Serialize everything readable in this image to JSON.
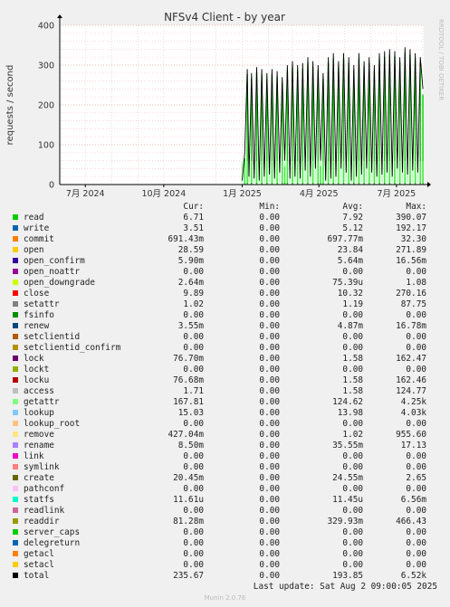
{
  "chart_data": {
    "type": "line",
    "title": "NFSv4 Client - by year",
    "ylabel": "requests / second",
    "side_label": "RRDTOOL / TOBI OETIKER",
    "ylim": [
      0,
      400
    ],
    "yticks": [
      0,
      100,
      200,
      300,
      400
    ],
    "xlim": [
      "2024-06-01",
      "2025-08-02"
    ],
    "xticks": [
      {
        "date": "2024-07-01",
        "label": "7月 2024"
      },
      {
        "date": "2024-10-01",
        "label": "10月 2024"
      },
      {
        "date": "2025-01-01",
        "label": "1月 2025"
      },
      {
        "date": "2025-04-01",
        "label": "4月 2025"
      },
      {
        "date": "2025-07-01",
        "label": "7月 2025"
      }
    ],
    "total_series": {
      "name": "total",
      "x": [
        "2025-01-01",
        "2025-01-04",
        "2025-01-07",
        "2025-01-09",
        "2025-01-12",
        "2025-01-15",
        "2025-01-18",
        "2025-01-21",
        "2025-01-24",
        "2025-01-27",
        "2025-01-30",
        "2025-02-02",
        "2025-02-05",
        "2025-02-08",
        "2025-02-11",
        "2025-02-14",
        "2025-02-17",
        "2025-02-20",
        "2025-02-23",
        "2025-02-26",
        "2025-03-01",
        "2025-03-04",
        "2025-03-07",
        "2025-03-10",
        "2025-03-13",
        "2025-03-16",
        "2025-03-19",
        "2025-03-22",
        "2025-03-25",
        "2025-03-28",
        "2025-03-31",
        "2025-04-03",
        "2025-04-06",
        "2025-04-09",
        "2025-04-12",
        "2025-04-15",
        "2025-04-18",
        "2025-04-21",
        "2025-04-24",
        "2025-04-27",
        "2025-04-30",
        "2025-05-03",
        "2025-05-06",
        "2025-05-09",
        "2025-05-12",
        "2025-05-15",
        "2025-05-18",
        "2025-05-21",
        "2025-05-24",
        "2025-05-27",
        "2025-05-30",
        "2025-06-02",
        "2025-06-05",
        "2025-06-08",
        "2025-06-11",
        "2025-06-14",
        "2025-06-17",
        "2025-06-20",
        "2025-06-23",
        "2025-06-26",
        "2025-06-29",
        "2025-07-02",
        "2025-07-05",
        "2025-07-08",
        "2025-07-11",
        "2025-07-14",
        "2025-07-17",
        "2025-07-20",
        "2025-07-23",
        "2025-07-26",
        "2025-07-29",
        "2025-08-01"
      ],
      "y": [
        10,
        80,
        290,
        20,
        280,
        15,
        295,
        10,
        290,
        20,
        280,
        25,
        290,
        15,
        285,
        30,
        270,
        60,
        300,
        15,
        310,
        20,
        300,
        15,
        305,
        35,
        320,
        20,
        310,
        40,
        300,
        60,
        280,
        10,
        320,
        15,
        330,
        20,
        310,
        40,
        330,
        30,
        320,
        10,
        300,
        20,
        330,
        25,
        310,
        40,
        320,
        30,
        300,
        20,
        330,
        25,
        335,
        30,
        340,
        20,
        335,
        40,
        320,
        30,
        345,
        25,
        340,
        35,
        330,
        30,
        320,
        240
      ]
    },
    "series": [
      {
        "name": "read",
        "cur": "6.71",
        "min": "0.00",
        "avg": "7.92",
        "max": "390.07",
        "color": "#00cc00"
      },
      {
        "name": "write",
        "cur": "3.51",
        "min": "0.00",
        "avg": "5.12",
        "max": "192.17",
        "color": "#0066b3"
      },
      {
        "name": "commit",
        "cur": "691.43m",
        "min": "0.00",
        "avg": "697.77m",
        "max": "32.30",
        "color": "#ff8000"
      },
      {
        "name": "open",
        "cur": "28.59",
        "min": "0.00",
        "avg": "23.84",
        "max": "271.89",
        "color": "#ffcc00"
      },
      {
        "name": "open_confirm",
        "cur": "5.90m",
        "min": "0.00",
        "avg": "5.64m",
        "max": "16.56m",
        "color": "#330099"
      },
      {
        "name": "open_noattr",
        "cur": "0.00",
        "min": "0.00",
        "avg": "0.00",
        "max": "0.00",
        "color": "#990099"
      },
      {
        "name": "open_downgrade",
        "cur": "2.64m",
        "min": "0.00",
        "avg": "75.39u",
        "max": "1.08",
        "color": "#ccff00"
      },
      {
        "name": "close",
        "cur": "9.89",
        "min": "0.00",
        "avg": "10.32",
        "max": "270.16",
        "color": "#ff0000"
      },
      {
        "name": "setattr",
        "cur": "1.02",
        "min": "0.00",
        "avg": "1.19",
        "max": "87.75",
        "color": "#808080"
      },
      {
        "name": "fsinfo",
        "cur": "0.00",
        "min": "0.00",
        "avg": "0.00",
        "max": "0.00",
        "color": "#008f00"
      },
      {
        "name": "renew",
        "cur": "3.55m",
        "min": "0.00",
        "avg": "4.87m",
        "max": "16.78m",
        "color": "#00487d"
      },
      {
        "name": "setclientid",
        "cur": "0.00",
        "min": "0.00",
        "avg": "0.00",
        "max": "0.00",
        "color": "#b35a00"
      },
      {
        "name": "setclientid_confirm",
        "cur": "0.00",
        "min": "0.00",
        "avg": "0.00",
        "max": "0.00",
        "color": "#b38f00"
      },
      {
        "name": "lock",
        "cur": "76.70m",
        "min": "0.00",
        "avg": "1.58",
        "max": "162.47",
        "color": "#6b006b"
      },
      {
        "name": "lockt",
        "cur": "0.00",
        "min": "0.00",
        "avg": "0.00",
        "max": "0.00",
        "color": "#8fb300"
      },
      {
        "name": "locku",
        "cur": "76.68m",
        "min": "0.00",
        "avg": "1.58",
        "max": "162.46",
        "color": "#b30000"
      },
      {
        "name": "access",
        "cur": "1.71",
        "min": "0.00",
        "avg": "1.58",
        "max": "124.77",
        "color": "#bebebe"
      },
      {
        "name": "getattr",
        "cur": "167.81",
        "min": "0.00",
        "avg": "124.62",
        "max": "4.25k",
        "color": "#80ff80"
      },
      {
        "name": "lookup",
        "cur": "15.03",
        "min": "0.00",
        "avg": "13.98",
        "max": "4.03k",
        "color": "#80c9ff"
      },
      {
        "name": "lookup_root",
        "cur": "0.00",
        "min": "0.00",
        "avg": "0.00",
        "max": "0.00",
        "color": "#ffc080"
      },
      {
        "name": "remove",
        "cur": "427.04m",
        "min": "0.00",
        "avg": "1.02",
        "max": "955.60",
        "color": "#ffe680"
      },
      {
        "name": "rename",
        "cur": "8.50m",
        "min": "0.00",
        "avg": "35.55m",
        "max": "17.13",
        "color": "#aa80ff"
      },
      {
        "name": "link",
        "cur": "0.00",
        "min": "0.00",
        "avg": "0.00",
        "max": "0.00",
        "color": "#ee00cc"
      },
      {
        "name": "symlink",
        "cur": "0.00",
        "min": "0.00",
        "avg": "0.00",
        "max": "0.00",
        "color": "#ff8080"
      },
      {
        "name": "create",
        "cur": "20.45m",
        "min": "0.00",
        "avg": "24.55m",
        "max": "2.65",
        "color": "#666600"
      },
      {
        "name": "pathconf",
        "cur": "0.00",
        "min": "0.00",
        "avg": "0.00",
        "max": "0.00",
        "color": "#ffbfff"
      },
      {
        "name": "statfs",
        "cur": "11.61u",
        "min": "0.00",
        "avg": "11.45u",
        "max": "6.56m",
        "color": "#00ffcc"
      },
      {
        "name": "readlink",
        "cur": "0.00",
        "min": "0.00",
        "avg": "0.00",
        "max": "0.00",
        "color": "#cc6699"
      },
      {
        "name": "readdir",
        "cur": "81.28m",
        "min": "0.00",
        "avg": "329.93m",
        "max": "466.43",
        "color": "#999900"
      },
      {
        "name": "server_caps",
        "cur": "0.00",
        "min": "0.00",
        "avg": "0.00",
        "max": "0.00",
        "color": "#00cc00"
      },
      {
        "name": "delegreturn",
        "cur": "0.00",
        "min": "0.00",
        "avg": "0.00",
        "max": "0.00",
        "color": "#0066b3"
      },
      {
        "name": "getacl",
        "cur": "0.00",
        "min": "0.00",
        "avg": "0.00",
        "max": "0.00",
        "color": "#ff8000"
      },
      {
        "name": "setacl",
        "cur": "0.00",
        "min": "0.00",
        "avg": "0.00",
        "max": "0.00",
        "color": "#ffcc00"
      },
      {
        "name": "total",
        "cur": "235.67",
        "min": "0.00",
        "avg": "193.85",
        "max": "6.52k",
        "color": "#000000"
      }
    ],
    "columns": [
      "Cur:",
      "Min:",
      "Avg:",
      "Max:"
    ],
    "grid": true,
    "last_update": "Last update: Sat Aug  2 09:00:05 2025",
    "generator": "Munin 2.0.76"
  }
}
